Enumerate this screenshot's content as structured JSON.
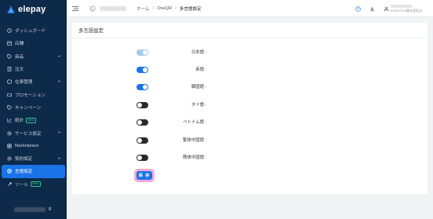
{
  "app": {
    "name": "elepay"
  },
  "sidebar": {
    "items": [
      {
        "label": "ダッシュボード",
        "icon": "clock-icon",
        "badge": "",
        "chevron": false,
        "active": false
      },
      {
        "label": "店舗",
        "icon": "store-icon",
        "badge": "",
        "chevron": false,
        "active": false
      },
      {
        "label": "商品",
        "icon": "tag-icon",
        "badge": "",
        "chevron": true,
        "active": false
      },
      {
        "label": "注文",
        "icon": "document-icon",
        "badge": "",
        "chevron": false,
        "active": false
      },
      {
        "label": "在庫管理",
        "icon": "box-icon",
        "badge": "",
        "chevron": true,
        "active": false
      },
      {
        "label": "プロモーション",
        "icon": "ticket-icon",
        "badge": "",
        "chevron": false,
        "active": false
      },
      {
        "label": "キャンペーン",
        "icon": "tag-icon",
        "badge": "",
        "chevron": false,
        "active": false
      },
      {
        "label": "統計",
        "icon": "chart-icon",
        "badge": "Beta",
        "chevron": false,
        "active": false
      },
      {
        "label": "サービス設定",
        "icon": "gear-icon",
        "badge": "",
        "chevron": true,
        "active": false
      },
      {
        "label": "Marketplace",
        "icon": "grid-icon",
        "badge": "",
        "chevron": false,
        "active": false
      },
      {
        "label": "契約設定",
        "icon": "gear-icon",
        "badge": "",
        "chevron": true,
        "active": false
      },
      {
        "label": "言語設定",
        "icon": "globe-icon",
        "badge": "",
        "chevron": false,
        "active": true
      },
      {
        "label": "ツール",
        "icon": "wrench-icon",
        "badge": "Beta",
        "chevron": false,
        "active": false
      }
    ],
    "footer_value": "0"
  },
  "header": {
    "breadcrumb": [
      "ホーム",
      "OneQR",
      "多言語設定"
    ],
    "user_sub": "ELESTYLE株式会社(E..."
  },
  "main": {
    "title": "多言語設定",
    "save_label": "保 存",
    "languages": [
      {
        "label": "日本語 :",
        "enabled": true,
        "disabled": true
      },
      {
        "label": "英語 :",
        "enabled": true,
        "disabled": false
      },
      {
        "label": "韓国語 :",
        "enabled": true,
        "disabled": false
      },
      {
        "label": "タイ語 :",
        "enabled": false,
        "disabled": false
      },
      {
        "label": "ベトナム語 :",
        "enabled": false,
        "disabled": false
      },
      {
        "label": "繁体中国語 :",
        "enabled": false,
        "disabled": false
      },
      {
        "label": "簡体中国語 :",
        "enabled": false,
        "disabled": false
      }
    ]
  },
  "colors": {
    "sidebar_bg": "#0d2a4a",
    "accent": "#1a74e8",
    "beta": "#35c58a",
    "highlight": "#f2a9d6"
  }
}
